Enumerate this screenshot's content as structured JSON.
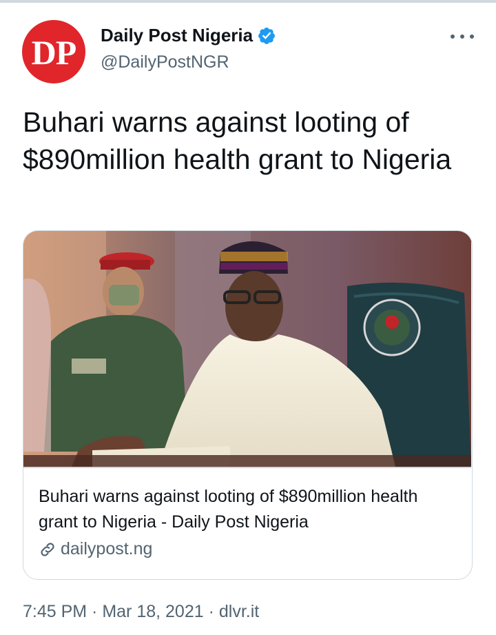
{
  "account": {
    "avatar_text": "DP",
    "display_name": "Daily Post Nigeria",
    "handle": "@DailyPostNGR",
    "verified": true
  },
  "tweet": {
    "text": "Buhari warns against looting of $890million health grant to Nigeria"
  },
  "card": {
    "title": "Buhari warns against looting of $890million health grant to Nigeria - Daily Post Nigeria",
    "domain": "dailypost.ng"
  },
  "meta": {
    "time": "7:45 PM",
    "separator": " · ",
    "date": "Mar 18, 2021",
    "source": "dlvr.it"
  },
  "colors": {
    "avatar_bg": "#e0262b",
    "verified": "#1d9bf0",
    "secondary_text": "#536471",
    "border": "#cfd9de"
  },
  "icons": {
    "verified": "verified-badge-icon",
    "more": "more-options-icon",
    "link": "link-icon"
  }
}
